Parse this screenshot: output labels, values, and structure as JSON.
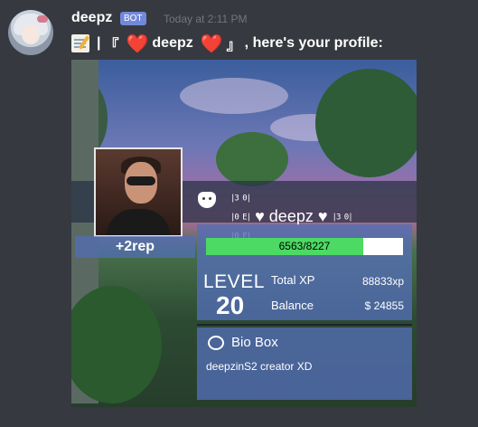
{
  "message": {
    "username": "deepz",
    "bot_tag": "BOT",
    "timestamp": "Today at 2:11 PM",
    "text_bar": "|",
    "text_open": "『",
    "text_heart": "❤️",
    "text_name": "deepz",
    "text_close": "』",
    "text_tail": ", here's your profile:",
    "icons": [
      "memo-icon",
      "heart-icon"
    ]
  },
  "profile": {
    "rep": "+2rep",
    "name_tag": "♥ deepz ♥",
    "bracket_left": "⁣",
    "xp_current": 6563,
    "xp_needed": 8227,
    "xp_text": "6563/8227",
    "level_label": "LEVEL",
    "level": "20",
    "total_xp_label": "Total XP",
    "total_xp_value": "88833xp",
    "balance_label": "Balance",
    "balance_value": "$ 24855",
    "bio_title": "Bio Box",
    "bio_text": "deepzinS2 creator XD"
  },
  "colors": {
    "xp_fill": "#4cd964",
    "panel": "#536eb6",
    "bot_tag": "#7289da"
  }
}
